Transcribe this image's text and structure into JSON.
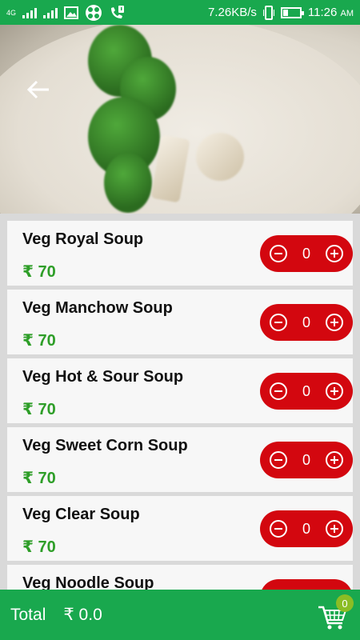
{
  "status_bar": {
    "network_label": "4G",
    "net_speed": "7.26KB/s",
    "time": "11:26",
    "ampm": "AM"
  },
  "header": {
    "back_icon": "arrow-left-icon"
  },
  "currency": "₹",
  "items": [
    {
      "name": "Veg Royal Soup",
      "price": "₹ 70",
      "qty": "0"
    },
    {
      "name": "Veg Manchow Soup",
      "price": "₹ 70",
      "qty": "0"
    },
    {
      "name": "Veg Hot & Sour Soup",
      "price": "₹ 70",
      "qty": "0"
    },
    {
      "name": "Veg Sweet Corn Soup",
      "price": "₹ 70",
      "qty": "0"
    },
    {
      "name": "Veg Clear Soup",
      "price": "₹ 70",
      "qty": "0"
    },
    {
      "name": "Veg Noodle Soup",
      "price": "",
      "qty": ""
    }
  ],
  "footer": {
    "total_label": "Total",
    "total_amount": "₹  0.0",
    "cart_count": "0",
    "cart_icon": "shopping-cart-icon"
  },
  "colors": {
    "primary_green": "#19a84e",
    "stepper_red": "#d3070f",
    "price_green": "#2e9e28",
    "badge_green": "#8bbd24"
  }
}
